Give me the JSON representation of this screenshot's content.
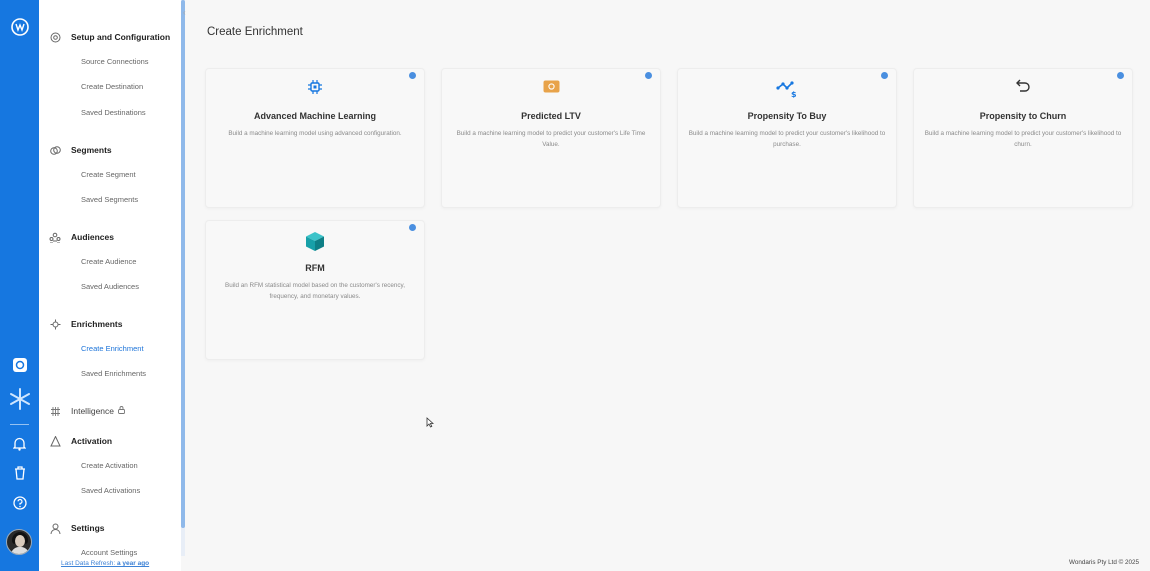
{
  "page": {
    "title": "Create Enrichment"
  },
  "nav": {
    "sections": [
      {
        "label": "Setup and Configuration",
        "icon": "gear-icon",
        "items": [
          "Source Connections",
          "Create Destination",
          "Saved Destinations"
        ]
      },
      {
        "label": "Segments",
        "icon": "segments-icon",
        "items": [
          "Create Segment",
          "Saved Segments"
        ]
      },
      {
        "label": "Audiences",
        "icon": "audiences-icon",
        "items": [
          "Create Audience",
          "Saved Audiences"
        ]
      },
      {
        "label": "Enrichments",
        "icon": "enrichments-icon",
        "items": [
          "Create Enrichment",
          "Saved Enrichments"
        ],
        "active_item": "Create Enrichment"
      },
      {
        "label": "Intelligence",
        "icon": "intelligence-icon",
        "locked": true,
        "items": []
      },
      {
        "label": "Activation",
        "icon": "activation-icon",
        "items": [
          "Create Activation",
          "Saved Activations"
        ]
      },
      {
        "label": "Settings",
        "icon": "user-icon",
        "items": [
          "Account Settings"
        ]
      }
    ],
    "refresh_prefix": "Last Data Refresh: ",
    "refresh_time": "a year ago"
  },
  "cards": [
    {
      "title": "Advanced Machine Learning",
      "description": "Build a machine learning model using advanced configuration.",
      "icon": "chip-icon",
      "icon_color": "#1677e0"
    },
    {
      "title": "Predicted LTV",
      "description": "Build a machine learning model to predict your customer's Life Time Value.",
      "icon": "money-icon",
      "icon_color": "#e8a34a"
    },
    {
      "title": "Propensity To Buy",
      "description": "Build a machine learning model to predict your customer's likelihood to purchase.",
      "icon": "trend-dollar-icon",
      "icon_color": "#1677e0"
    },
    {
      "title": "Propensity to Churn",
      "description": "Build a machine learning model to predict your customer's likelihood to churn.",
      "icon": "undo-arrow-icon",
      "icon_color": "#333333"
    },
    {
      "title": "RFM",
      "description": "Build an RFM statistical model based on the customer's recency, frequency, and monetary values.",
      "icon": "cube-icon",
      "icon_color": "#17a0a8"
    }
  ],
  "footer": {
    "copyright": "Wondaris Pty Ltd © 2025"
  },
  "colors": {
    "rail": "#1677e0",
    "accent": "#1d74d9"
  }
}
